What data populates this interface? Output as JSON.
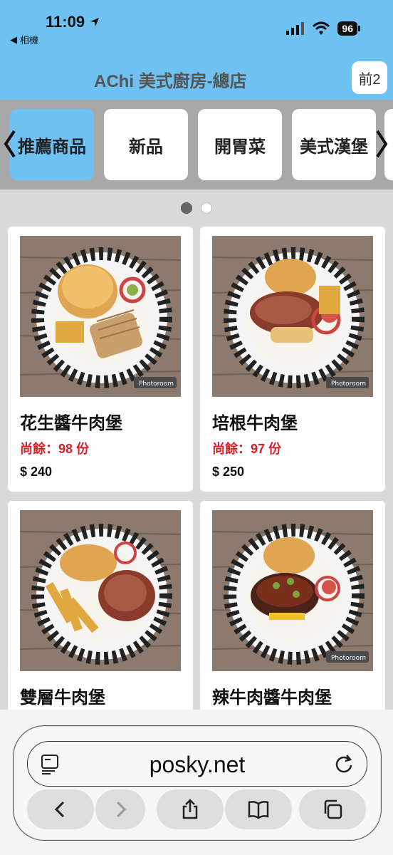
{
  "status": {
    "time": "11:09",
    "back_app": "相機",
    "battery": "96"
  },
  "header": {
    "title": "AChi 美式廚房-總店",
    "queue_label": "前2"
  },
  "categories": [
    "推薦商品",
    "新品",
    "開胃菜",
    "美式漢堡"
  ],
  "pager": {
    "active_index": 0,
    "count": 2
  },
  "products": [
    {
      "name": "花生醬牛肉堡",
      "stock": "尚餘：98 份",
      "price": "$ 240",
      "watermark": "Photoroom"
    },
    {
      "name": "培根牛肉堡",
      "stock": "尚餘：97 份",
      "price": "$ 250",
      "watermark": "Photoroom"
    },
    {
      "name": "雙層牛肉堡"
    },
    {
      "name": "辣牛肉醬牛肉堡",
      "watermark": "Photoroom"
    }
  ],
  "browser": {
    "url": "posky.net"
  },
  "colors": {
    "accent": "#6ec1f0",
    "stock_red": "#d81f26"
  },
  "icons": [
    "location-arrow-icon",
    "signal-icon",
    "wifi-icon",
    "battery-icon",
    "chevron-left-icon",
    "chevron-right-icon",
    "reader-icon",
    "reload-icon",
    "back-icon",
    "forward-icon",
    "share-icon",
    "bookmarks-icon",
    "tabs-icon"
  ]
}
